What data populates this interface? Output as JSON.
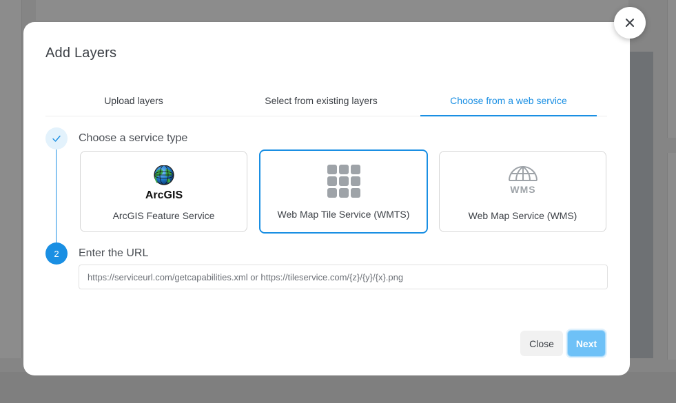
{
  "modal": {
    "title": "Add Layers",
    "close_icon": "close-icon"
  },
  "tabs": [
    {
      "label": "Upload layers",
      "active": false
    },
    {
      "label": "Select from existing layers",
      "active": false
    },
    {
      "label": "Choose from a web service",
      "active": true
    }
  ],
  "steps": [
    {
      "status": "done",
      "icon": "check-icon",
      "label": "Choose a service type"
    },
    {
      "status": "current",
      "number": "2",
      "label": "Enter the URL"
    }
  ],
  "service_cards": [
    {
      "label": "ArcGIS Feature Service",
      "icon": "arcgis-logo",
      "logo_text": "ArcGIS",
      "selected": false
    },
    {
      "label": "Web Map Tile Service (WMTS)",
      "icon": "tile-grid-icon",
      "selected": true
    },
    {
      "label": "Web Map Service (WMS)",
      "icon": "wms-globe-icon",
      "logo_text": "WMS",
      "selected": false
    }
  ],
  "url_input": {
    "placeholder": "https://serviceurl.com/getcapabilities.xml or https://tileservice.com/{z}/{y}/{x}.png",
    "value": ""
  },
  "buttons": {
    "close_label": "Close",
    "next_label": "Next"
  },
  "colors": {
    "accent": "#1a8fe3",
    "next_button": "#6ec1f7",
    "tile_icon": "#9ea3a8"
  }
}
